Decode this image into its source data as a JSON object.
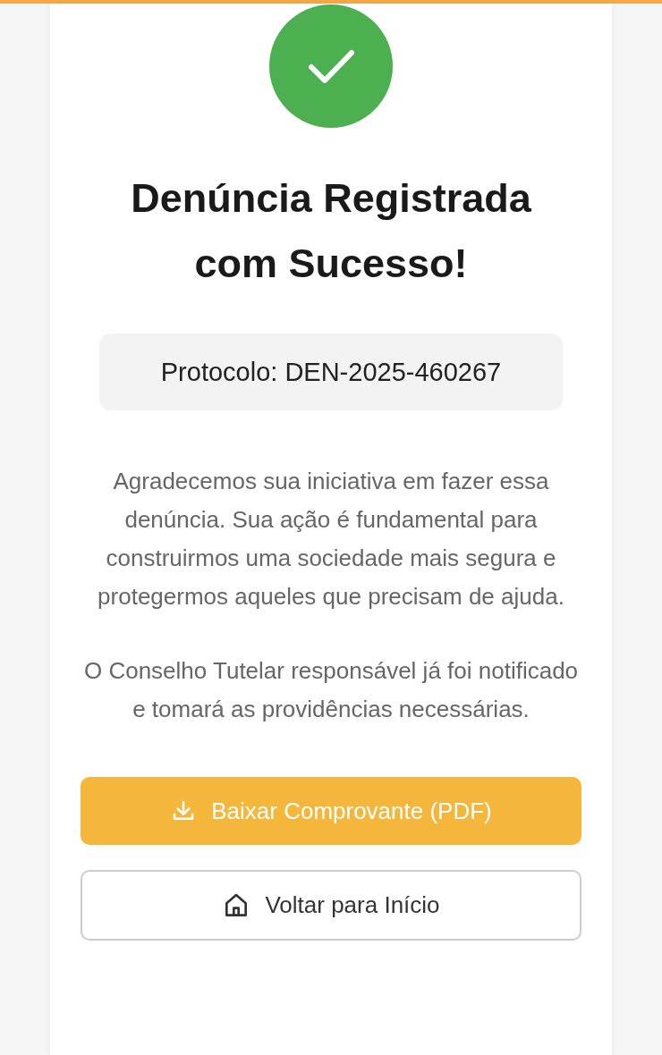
{
  "title": "Denúncia Registrada com Sucesso!",
  "protocol": "Protocolo: DEN-2025-460267",
  "paragraphs": [
    "Agradecemos sua iniciativa em fazer essa denúncia. Sua ação é fundamental para construirmos uma sociedade mais segura e protegermos aqueles que precisam de ajuda.",
    "O Conselho Tutelar responsável já foi notificado e tomará as providências necessárias."
  ],
  "buttons": [
    {
      "kind": "download",
      "label": "Baixar Comprovante (PDF)"
    },
    {
      "kind": "home",
      "label": "Voltar para Início"
    }
  ]
}
